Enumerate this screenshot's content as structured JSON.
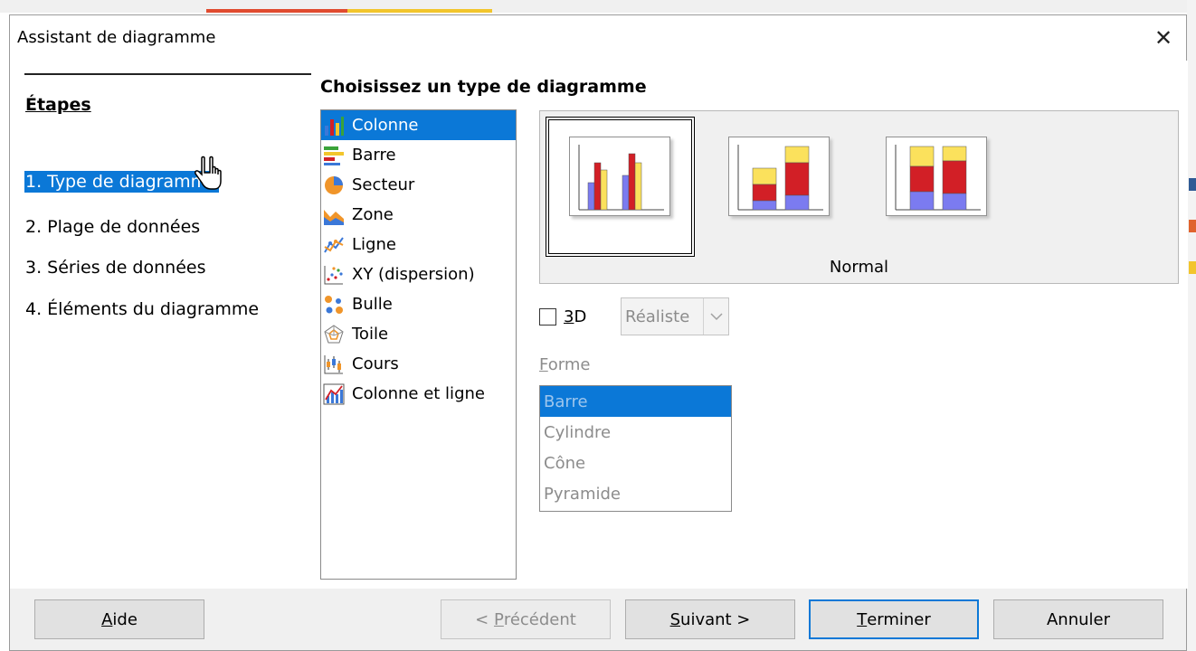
{
  "window": {
    "title": "Assistant de diagramme",
    "close_glyph": "✕"
  },
  "steps": {
    "heading": "Étapes",
    "items": [
      {
        "label": "1. Type de diagramme",
        "active": true
      },
      {
        "label": "2. Plage de données",
        "active": false
      },
      {
        "label": "3. Séries de données",
        "active": false
      },
      {
        "label": "4. Éléments du diagramme",
        "active": false
      }
    ]
  },
  "chart_type": {
    "heading": "Choisissez un type de diagramme",
    "types": [
      {
        "label": "Colonne",
        "icon": "column-chart-icon",
        "selected": true
      },
      {
        "label": "Barre",
        "icon": "bar-chart-icon",
        "selected": false
      },
      {
        "label": "Secteur",
        "icon": "pie-chart-icon",
        "selected": false
      },
      {
        "label": "Zone",
        "icon": "area-chart-icon",
        "selected": false
      },
      {
        "label": "Ligne",
        "icon": "line-chart-icon",
        "selected": false
      },
      {
        "label": "XY (dispersion)",
        "icon": "scatter-chart-icon",
        "selected": false
      },
      {
        "label": "Bulle",
        "icon": "bubble-chart-icon",
        "selected": false
      },
      {
        "label": "Toile",
        "icon": "net-chart-icon",
        "selected": false
      },
      {
        "label": "Cours",
        "icon": "stock-chart-icon",
        "selected": false
      },
      {
        "label": "Colonne et ligne",
        "icon": "column-line-chart-icon",
        "selected": false
      }
    ],
    "variant_label": "Normal",
    "variants": [
      {
        "name": "normal",
        "selected": true
      },
      {
        "name": "stacked",
        "selected": false
      },
      {
        "name": "percent-stacked",
        "selected": false
      }
    ],
    "threed": {
      "prefix": "",
      "mnemonic": "3",
      "rest": "D",
      "checked": false
    },
    "combo_value": "Réaliste",
    "shape": {
      "label_mnemonic": "F",
      "label_rest": "orme",
      "items": [
        {
          "label": "Barre",
          "selected": true
        },
        {
          "label": "Cylindre",
          "selected": false
        },
        {
          "label": "Cône",
          "selected": false
        },
        {
          "label": "Pyramide",
          "selected": false
        }
      ]
    }
  },
  "buttons": {
    "help": {
      "mnemonic": "A",
      "rest": "ide"
    },
    "previous": {
      "prefix": "< ",
      "mnemonic": "P",
      "rest": "récédent"
    },
    "next": {
      "mnemonic": "S",
      "rest": "uivant >"
    },
    "finish": {
      "mnemonic": "T",
      "rest": "erminer"
    },
    "cancel": {
      "label": "Annuler"
    }
  },
  "colors": {
    "accent": "#0b78d7",
    "bar_blue": "#7b7bf0",
    "bar_red": "#d21f26",
    "bar_yellow": "#fbe15c"
  }
}
